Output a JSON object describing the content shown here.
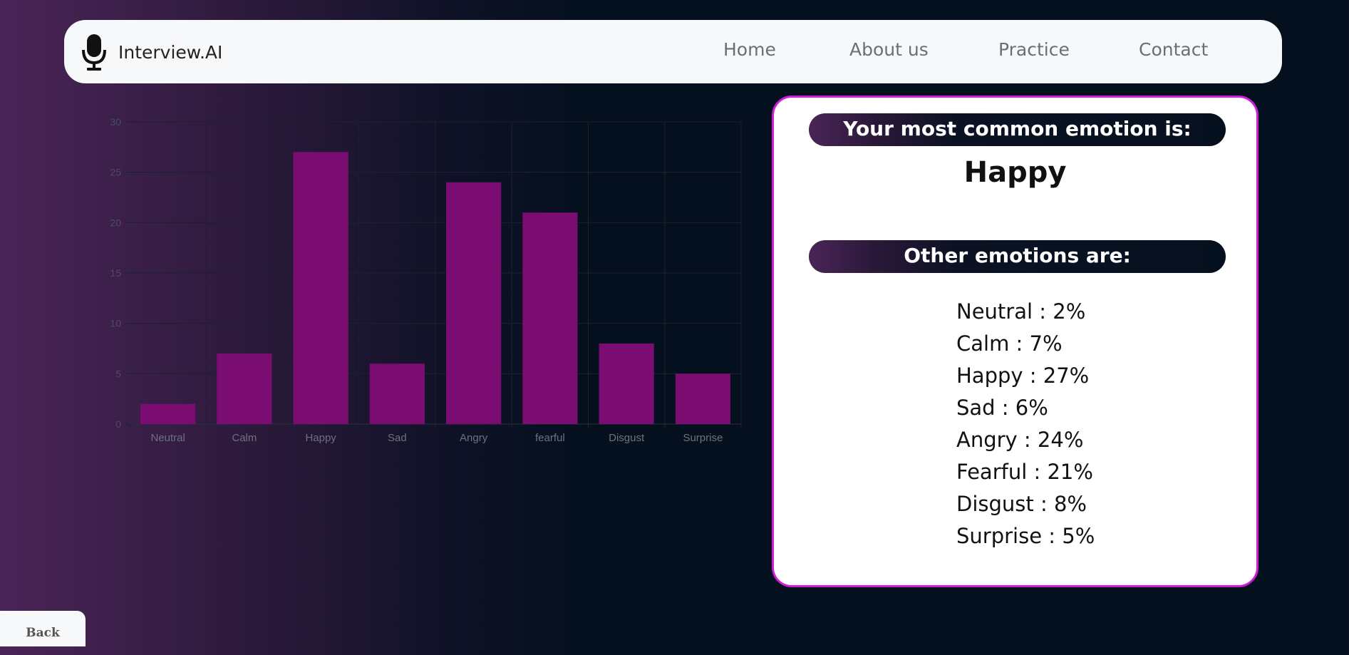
{
  "app": {
    "brand_name": "Interview.AI",
    "brand_icon": "microphone-icon"
  },
  "nav": {
    "items": [
      {
        "label": "Home"
      },
      {
        "label": "About us"
      },
      {
        "label": "Practice"
      },
      {
        "label": "Contact"
      }
    ]
  },
  "panel": {
    "most_common_heading": "Your most common emotion is:",
    "most_common_value": "Happy",
    "others_heading": "Other emotions are:",
    "emotions": [
      "Neutral : 2%",
      "Calm : 7%",
      "Happy : 27%",
      "Sad : 6%",
      "Angry : 24%",
      "Fearful : 21%",
      "Disgust : 8%",
      "Surprise : 5%"
    ]
  },
  "back_button": {
    "label": "Back"
  },
  "colors": {
    "bar": "#7b0c72",
    "panel_border": "#d21ad9",
    "background_dark": "#05101f",
    "background_purple": "#4a2558"
  },
  "chart_data": {
    "type": "bar",
    "categories": [
      "Neutral",
      "Calm",
      "Happy",
      "Sad",
      "Angry",
      "fearful",
      "Disgust",
      "Surprise"
    ],
    "values": [
      2,
      7,
      27,
      6,
      24,
      21,
      8,
      5
    ],
    "ylim": [
      0,
      30
    ],
    "yticks": [
      0,
      5,
      10,
      15,
      20,
      25,
      30
    ],
    "grid": true,
    "legend": "none",
    "title": "",
    "xlabel": "",
    "ylabel": ""
  }
}
